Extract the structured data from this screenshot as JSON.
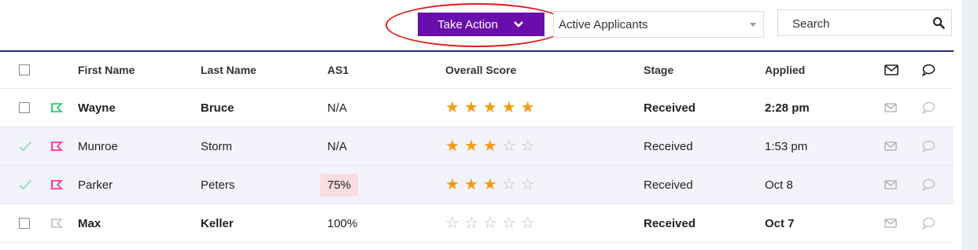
{
  "toolbar": {
    "take_action_label": "Take Action",
    "filter_value": "Active Applicants",
    "search_placeholder": "Search"
  },
  "colors": {
    "take_action_bg": "#6a0dad",
    "header_rule": "#232b7a",
    "star_filled": "#f39c12",
    "flag_green": "#2ecc71",
    "flag_pink": "#ff3399",
    "check_green": "#7ed6b4",
    "as1_highlight": "#f9dde1"
  },
  "table": {
    "headers": {
      "first_name": "First Name",
      "last_name": "Last Name",
      "as1": "AS1",
      "overall_score": "Overall Score",
      "stage": "Stage",
      "applied": "Applied"
    },
    "rows": [
      {
        "first": "Wayne",
        "last": "Bruce",
        "as1": "N/A",
        "rating": 5,
        "stage": "Received",
        "applied": "2:28 pm",
        "selected": false,
        "flag": "green",
        "unread": true
      },
      {
        "first": "Munroe",
        "last": "Storm",
        "as1": "N/A",
        "rating": 3,
        "stage": "Received",
        "applied": "1:53 pm",
        "selected": true,
        "flag": "pink",
        "unread": false
      },
      {
        "first": "Parker",
        "last": "Peters",
        "as1": "75%",
        "rating": 3,
        "stage": "Received",
        "applied": "Oct 8",
        "selected": true,
        "flag": "pink",
        "unread": false
      },
      {
        "first": "Max",
        "last": "Keller",
        "as1": "100%",
        "rating": 0,
        "stage": "Received",
        "applied": "Oct 7",
        "selected": false,
        "flag": "gray",
        "unread": true
      }
    ]
  }
}
